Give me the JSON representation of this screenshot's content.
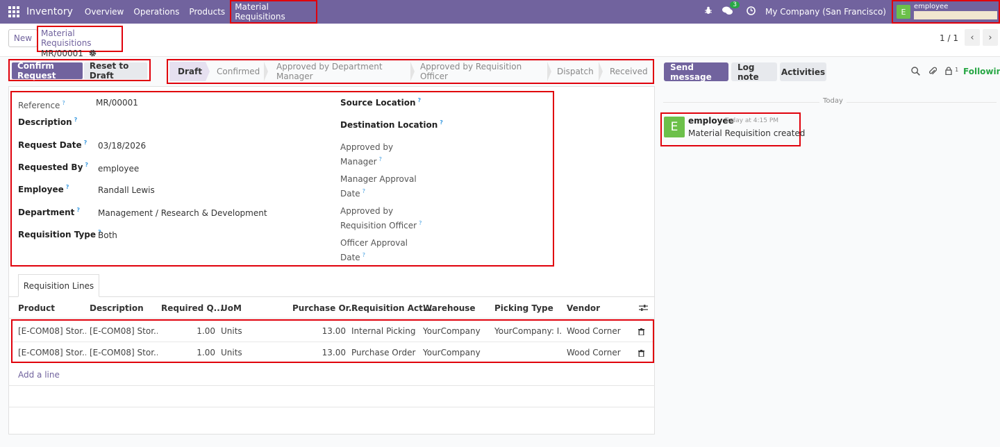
{
  "nav": {
    "brand": "Inventory",
    "items": [
      "Overview",
      "Operations",
      "Products",
      "Material Requisitions"
    ],
    "messages_count": "3",
    "company": "My Company (San Francisco)",
    "user_initial": "E",
    "user_name": "employee"
  },
  "control": {
    "new_label": "New",
    "breadcrumb_parent": "Material Requisitions",
    "breadcrumb_current": "MR/00001",
    "pager": "1 / 1"
  },
  "actions": {
    "confirm": "Confirm Request",
    "reset": "Reset to Draft"
  },
  "stages": [
    "Draft",
    "Confirmed",
    "Approved by Department Manager",
    "Approved by Requisition Officer",
    "Dispatch",
    "Received"
  ],
  "form": {
    "reference_label": "Reference",
    "reference": "MR/00001",
    "description_label": "Description",
    "request_date_label": "Request Date",
    "request_date": "03/18/2026",
    "requested_by_label": "Requested By",
    "requested_by": "employee",
    "employee_label": "Employee",
    "employee": "Randall Lewis",
    "department_label": "Department",
    "department": "Management / Research & Development",
    "req_type_label": "Requisition Type",
    "req_type": "Both",
    "source_label": "Source Location",
    "dest_label": "Destination Location",
    "approved_mgr_1": "Approved by",
    "approved_mgr_2": "Manager",
    "mgr_date_1": "Manager Approval",
    "mgr_date_2": "Date",
    "approved_off_1": "Approved by",
    "approved_off_2": "Requisition Officer",
    "off_date_1": "Officer Approval",
    "off_date_2": "Date"
  },
  "lines": {
    "tab": "Requisition Lines",
    "headers": [
      "Product",
      "Description",
      "Required Q...",
      "UoM",
      "Purchase Or...",
      "Requisition Act...",
      "Warehouse",
      "Picking Type",
      "Vendor"
    ],
    "rows": [
      {
        "product": "[E-COM08] Stor...",
        "description": "[E-COM08] Stor...",
        "qty": "1.00",
        "uom": "Units",
        "po_qty": "13.00",
        "action": "Internal Picking",
        "warehouse": "YourCompany",
        "picking": "YourCompany: I...",
        "vendor": "Wood Corner"
      },
      {
        "product": "[E-COM08] Stor...",
        "description": "[E-COM08] Stor...",
        "qty": "1.00",
        "uom": "Units",
        "po_qty": "13.00",
        "action": "Purchase Order",
        "warehouse": "YourCompany",
        "picking": "",
        "vendor": "Wood Corner"
      }
    ],
    "add_line": "Add a line"
  },
  "chatter": {
    "send_message": "Send message",
    "log_note": "Log note",
    "activities": "Activities",
    "followers_count": "1",
    "following": "Following",
    "today": "Today",
    "author_initial": "E",
    "author": "employee",
    "time": "Today at 4:15 PM",
    "body": "Material Requisition created"
  }
}
